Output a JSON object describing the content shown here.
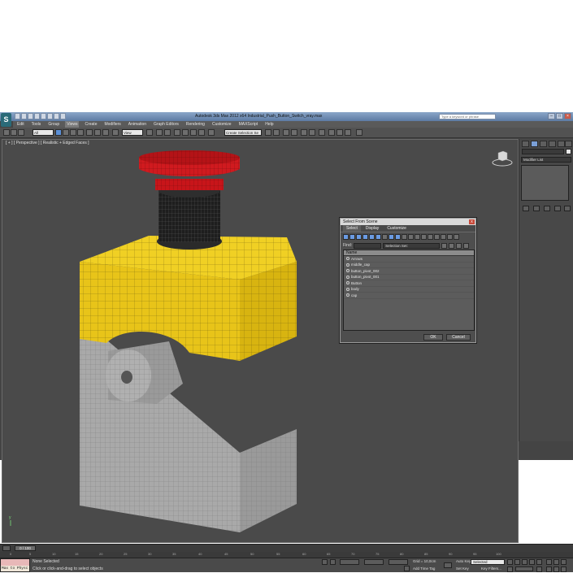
{
  "window": {
    "title": "Autodesk 3ds Max 2012 x64     Industrial_Push_Button_Switch_vray.max",
    "search_placeholder": "Type a keyword or phrase"
  },
  "menu": [
    "Edit",
    "Tools",
    "Group",
    "Views",
    "Create",
    "Modifiers",
    "Animation",
    "Graph Editors",
    "Rendering",
    "Customize",
    "MAXScript",
    "Help"
  ],
  "toolbar": {
    "filter_value": "All",
    "view_value": "View",
    "selection_set": "Create Selection Se"
  },
  "viewport": {
    "label": "[ + ] [ Perspective ] [ Realistic + Edged Faces ]",
    "axis_y": "y"
  },
  "command_panel": {
    "modifier_list": "Modifier List"
  },
  "dialog": {
    "title": "Select From Scene",
    "close": "x",
    "tabs": [
      "Select",
      "Display",
      "Customize"
    ],
    "find_label": "Find:",
    "selection_set_label": "Selection Set:",
    "column_name": "Name",
    "items": [
      "Arrows",
      "middle_cap",
      "button_pivot_002",
      "button_pivot_001",
      "Button",
      "body",
      "cap"
    ],
    "ok": "OK",
    "cancel": "Cancel"
  },
  "timeline": {
    "slider_label": "0 / 100",
    "ticks": [
      "0",
      "5",
      "10",
      "15",
      "20",
      "25",
      "30",
      "35",
      "40",
      "45",
      "50",
      "55",
      "60",
      "65",
      "70",
      "75",
      "80",
      "85",
      "90",
      "95",
      "100"
    ]
  },
  "status": {
    "maxscript_text": "Max to Physc",
    "line1": "None Selected",
    "line2": "Click or click-and-drag to select objects",
    "grid": "Grid = 10,0cm",
    "add_time_tag": "Add Time Tag",
    "auto_key": "Auto Key",
    "set_key": "Set Key",
    "selected": "Selected",
    "key_filters": "Key Filters..."
  },
  "colors": {
    "body_yellow": "#e8c419",
    "base_grey": "#a9a9a9",
    "cap_red": "#c8151a",
    "viewport_bg": "#4a4a4a"
  }
}
